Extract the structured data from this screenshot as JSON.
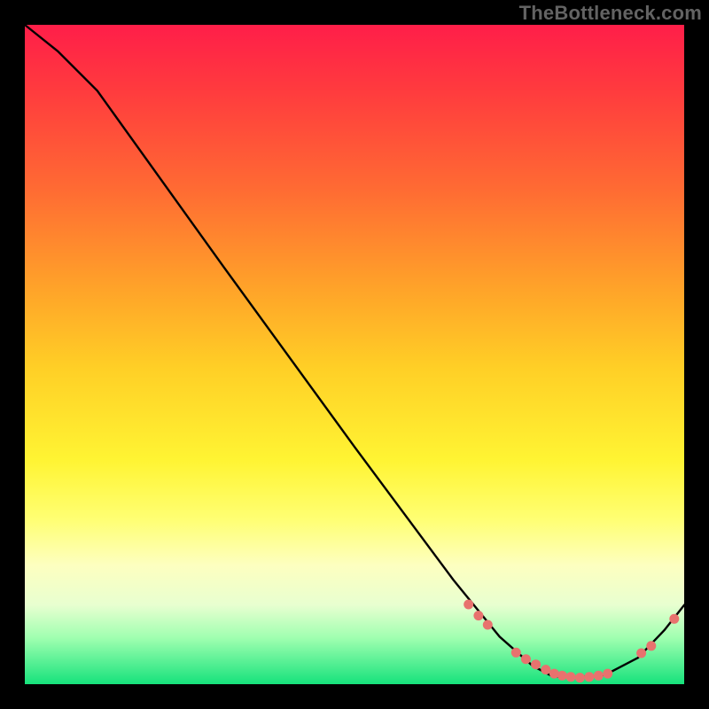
{
  "watermark": "TheBottleneck.com",
  "chart_data": {
    "type": "line",
    "title": "",
    "xlabel": "",
    "ylabel": "",
    "xlim": [
      0,
      1
    ],
    "ylim": [
      0,
      1
    ],
    "note": "Bottleneck-style curve on a red→green vertical gradient. Axes are unlabeled; data are normalized plot coordinates (0,0 = bottom-left, 1,1 = top-right). The line runs from top-left, descends to a valley near x≈0.82, then rises. Markers (series 'dots') cluster on the valley and the rising tail.",
    "series": [
      {
        "name": "curve",
        "x": [
          0.0,
          0.05,
          0.11,
          0.3,
          0.5,
          0.65,
          0.72,
          0.77,
          0.8,
          0.83,
          0.88,
          0.93,
          0.97,
          1.0
        ],
        "y": [
          1.0,
          0.96,
          0.9,
          0.635,
          0.36,
          0.158,
          0.072,
          0.028,
          0.012,
          0.01,
          0.014,
          0.04,
          0.082,
          0.12
        ]
      },
      {
        "name": "dots",
        "x": [
          0.673,
          0.688,
          0.702,
          0.745,
          0.76,
          0.775,
          0.79,
          0.803,
          0.815,
          0.828,
          0.842,
          0.856,
          0.87,
          0.884,
          0.935,
          0.95,
          0.985
        ],
        "y": [
          0.121,
          0.104,
          0.09,
          0.048,
          0.038,
          0.03,
          0.022,
          0.016,
          0.013,
          0.011,
          0.01,
          0.011,
          0.013,
          0.016,
          0.047,
          0.058,
          0.099
        ]
      }
    ],
    "colors": {
      "line": "#000000",
      "dots": "#e8726e",
      "gradient_top": "#ff1e49",
      "gradient_bottom": "#16e27c"
    }
  }
}
